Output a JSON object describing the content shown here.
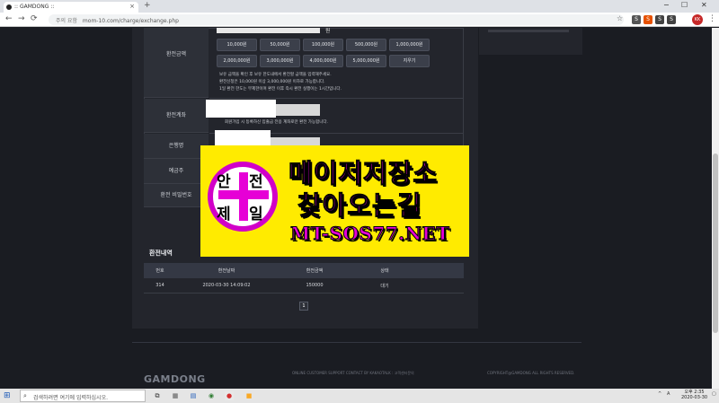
{
  "browser": {
    "tab_title": ":: GAMDONG ::",
    "tab_close": "×",
    "new_tab": "+",
    "security_label": "주의 요함",
    "url": "mom-10.com/charge/exchange.php",
    "window_controls": [
      "−",
      "☐",
      "✕"
    ],
    "avatar_label": "KK",
    "extensions": [
      {
        "label": "S",
        "color": "#555555"
      },
      {
        "label": "S",
        "color": "#e65100"
      },
      {
        "label": "S",
        "color": "#424242"
      },
      {
        "label": "S",
        "color": "#424242"
      }
    ]
  },
  "form": {
    "amount_unit": "원",
    "labels": {
      "amount": "환전금액",
      "password": "환전계좌",
      "bank": "은행명",
      "holder": "예금주",
      "pw": "환전 비밀번호"
    },
    "amount_buttons_row1": [
      "10,000원",
      "50,000원",
      "100,000원",
      "500,000원",
      "1,000,000원"
    ],
    "amount_buttons_row2": [
      "2,000,000원",
      "3,000,000원",
      "4,000,000원",
      "5,000,000원",
      "지우기"
    ],
    "notes": [
      "보유 금액을 확인 후 보유 한도내에서 환전할 금액을 입력해주세요.",
      "환전신청은 10,000원 이상 3,000,000원 이하로 가능합니다.",
      "1일 환전 한도는 무제한이며 환전 이후 즉시 환전 실행이는 1시간입니다."
    ],
    "account_note": "회원가입 시 등록하신 입출금 전용 계좌로만 환전 가능합니다."
  },
  "ad": {
    "badge_chars": [
      "안",
      "전",
      "제",
      "일"
    ],
    "line1": "메이저저장소",
    "line2": "찾아오는길",
    "url": "MT-SOS77.NET"
  },
  "history": {
    "title": "환전내역",
    "headers": [
      "번호",
      "환전날짜",
      "환전금액",
      "상태"
    ],
    "rows": [
      [
        "314",
        "2020-03-30 14:09:02",
        "150000",
        "대기"
      ]
    ],
    "page": "1"
  },
  "footer": {
    "logo": "GAMDONG",
    "mid_text": "ONLINE CUSTOMER SUPPORT CONTACT BY KAKAOTALK : 고객센터문의",
    "right_text": "COPYRIGHT@GAMDONG ALL RIGHTS RESERVED."
  },
  "taskbar": {
    "search_placeholder": "검색하려면 여기에 입력하십시오.",
    "tray_lang": "A",
    "time": "오후 2:35",
    "date": "2020-03-30"
  },
  "colors": {
    "ad_bg": "#ffeb00",
    "ad_text": "#e600d6",
    "panel_bg": "#23252c",
    "page_bg": "#1a1c22"
  }
}
